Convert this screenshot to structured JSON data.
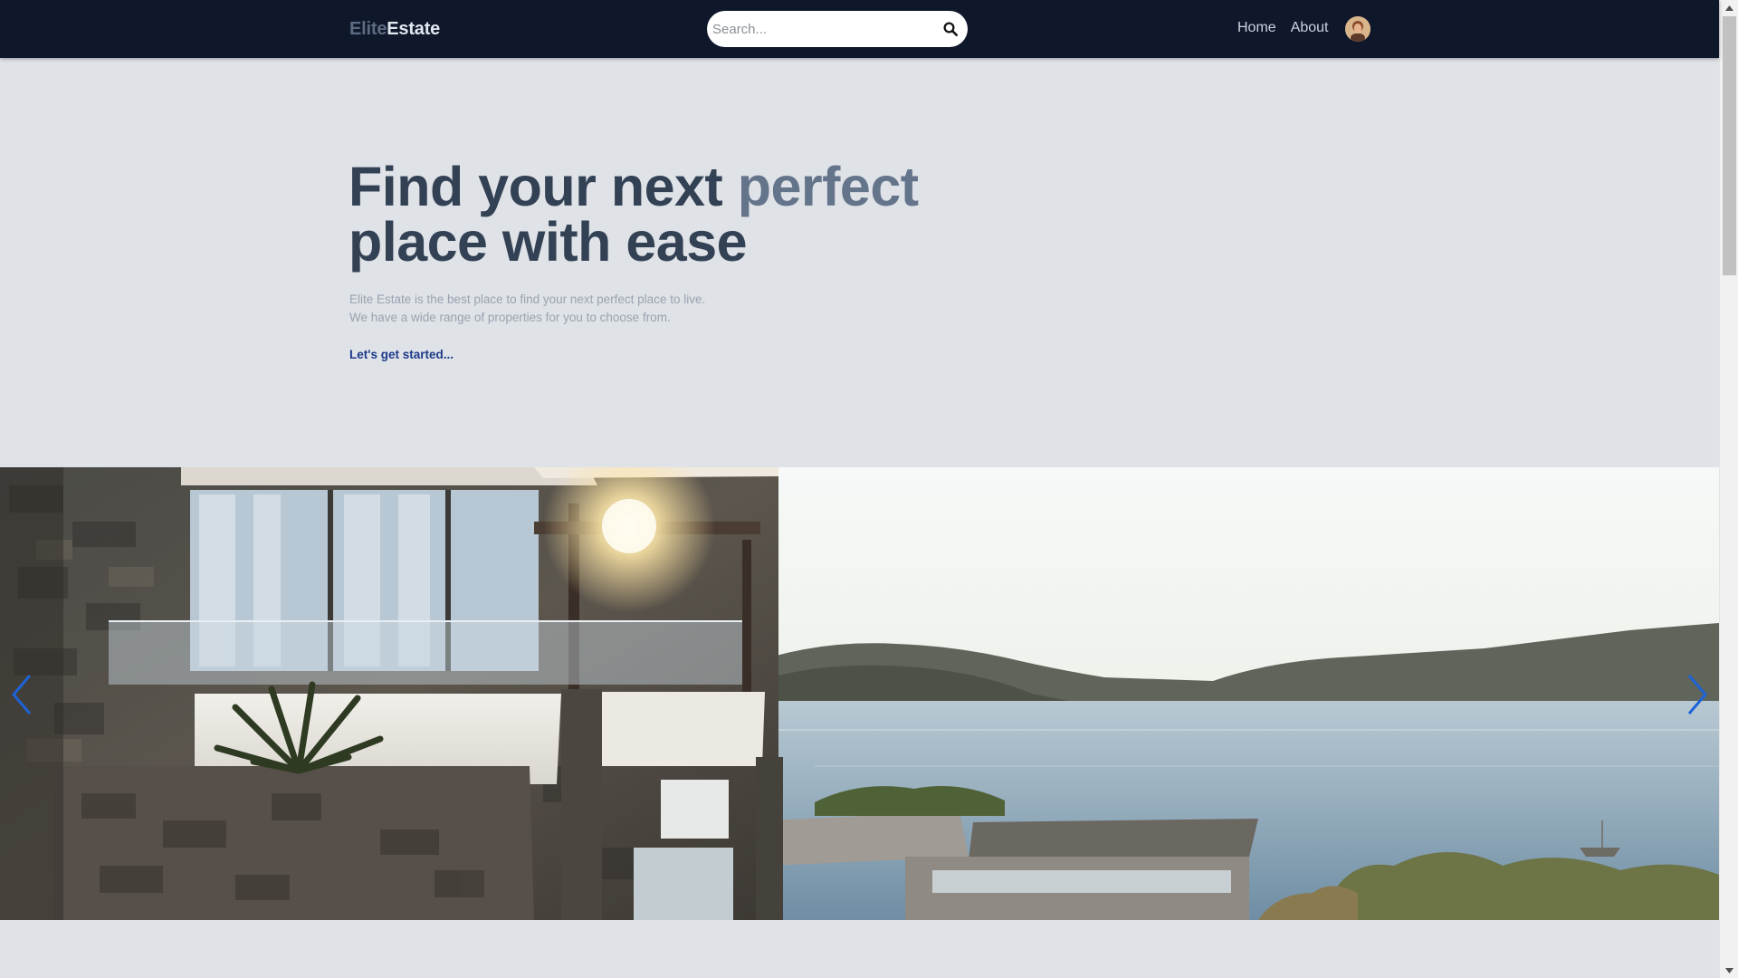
{
  "navbar": {
    "brand_part1": "Elite",
    "brand_part2": "Estate",
    "search_placeholder": "Search...",
    "search_icon": "search-icon",
    "links": [
      {
        "label": "Home"
      },
      {
        "label": "About"
      }
    ],
    "avatar_icon": "user-avatar"
  },
  "hero": {
    "title_part1": "Find your next ",
    "title_accent": "perfect",
    "title_part2": "place with ease",
    "subtitle_line1": "Elite Estate is the best place to find your next perfect place to live.",
    "subtitle_line2": "We have a wide range of properties for you to choose from.",
    "cta_label": "Let's get started..."
  },
  "slider": {
    "prev_icon": "chevron-left-icon",
    "next_icon": "chevron-right-icon",
    "image_subject": "modern-stone-villa-overlooking-bay"
  },
  "colors": {
    "nav_bg": "#0f172a",
    "page_bg": "#dfe2e7",
    "title": "#334155",
    "title_accent": "#64748b",
    "cta": "#1e3a8a",
    "arrow": "#1d63d8"
  }
}
